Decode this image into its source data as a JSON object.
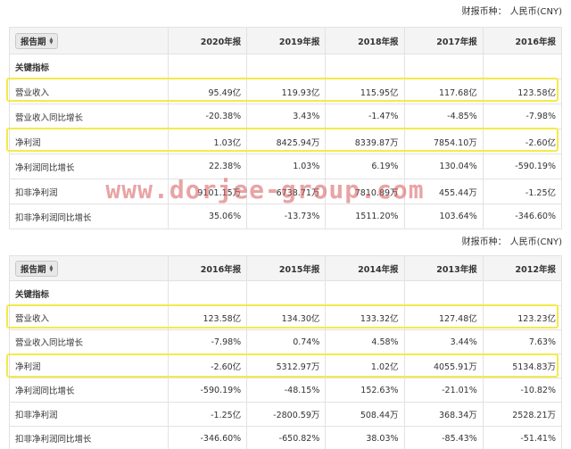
{
  "currency_label": "财报币种：",
  "currency_value": "人民币(CNY)",
  "period_label": "报告期",
  "section_label": "关键指标",
  "watermark": "www.dorjee-group.com",
  "tables": [
    {
      "years": [
        "2020年报",
        "2019年报",
        "2018年报",
        "2017年报",
        "2016年报"
      ],
      "rows": [
        {
          "label": "营业收入",
          "values": [
            "95.49亿",
            "119.93亿",
            "115.95亿",
            "117.68亿",
            "123.58亿"
          ]
        },
        {
          "label": "营业收入同比增长",
          "values": [
            "-20.38%",
            "3.43%",
            "-1.47%",
            "-4.85%",
            "-7.98%"
          ]
        },
        {
          "label": "净利润",
          "values": [
            "1.03亿",
            "8425.94万",
            "8339.87万",
            "7854.10万",
            "-2.60亿"
          ]
        },
        {
          "label": "净利润同比增长",
          "values": [
            "22.38%",
            "1.03%",
            "6.19%",
            "130.04%",
            "-590.19%"
          ]
        },
        {
          "label": "扣非净利润",
          "values": [
            "9101.15万",
            "6738.71万",
            "7810.89万",
            "455.44万",
            "-1.25亿"
          ]
        },
        {
          "label": "扣非净利润同比增长",
          "values": [
            "35.06%",
            "-13.73%",
            "1511.20%",
            "103.64%",
            "-346.60%"
          ]
        }
      ]
    },
    {
      "years": [
        "2016年报",
        "2015年报",
        "2014年报",
        "2013年报",
        "2012年报"
      ],
      "rows": [
        {
          "label": "营业收入",
          "values": [
            "123.58亿",
            "134.30亿",
            "133.32亿",
            "127.48亿",
            "123.23亿"
          ]
        },
        {
          "label": "营业收入同比增长",
          "values": [
            "-7.98%",
            "0.74%",
            "4.58%",
            "3.44%",
            "7.63%"
          ]
        },
        {
          "label": "净利润",
          "values": [
            "-2.60亿",
            "5312.97万",
            "1.02亿",
            "4055.91万",
            "5134.83万"
          ]
        },
        {
          "label": "净利润同比增长",
          "values": [
            "-590.19%",
            "-48.15%",
            "152.63%",
            "-21.01%",
            "-10.82%"
          ]
        },
        {
          "label": "扣非净利润",
          "values": [
            "-1.25亿",
            "-2800.59万",
            "508.44万",
            "368.34万",
            "2528.21万"
          ]
        },
        {
          "label": "扣非净利润同比增长",
          "values": [
            "-346.60%",
            "-650.82%",
            "38.03%",
            "-85.43%",
            "-51.41%"
          ]
        }
      ]
    }
  ]
}
